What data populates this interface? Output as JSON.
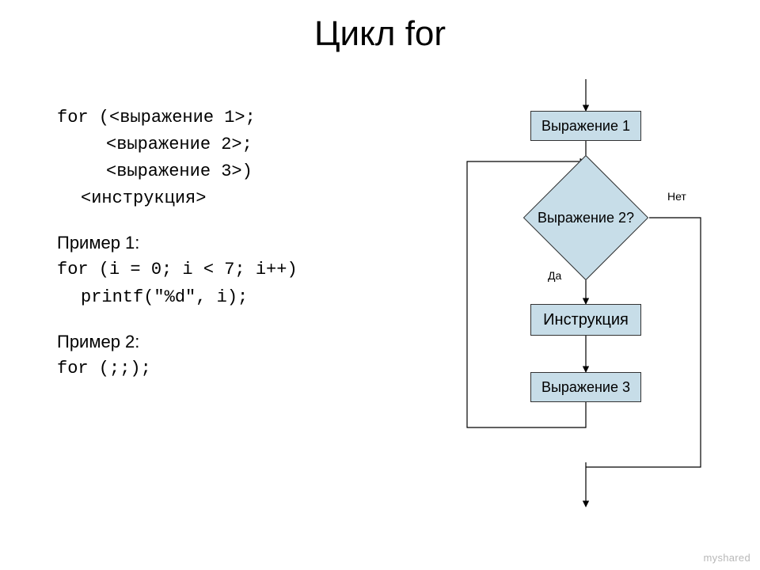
{
  "title": "Цикл for",
  "code": {
    "l1": "for (<выражение 1>;",
    "l2": "<выражение 2>;",
    "l3": "<выражение 3>)",
    "l4": "<инструкция>"
  },
  "ex1": {
    "heading": "Пример 1:",
    "l1": "for (i = 0; i < 7; i++)",
    "l2": "printf(\"%d\", i);"
  },
  "ex2": {
    "heading": "Пример 2:",
    "l1": "for (;;);"
  },
  "flow": {
    "init": "Выражение 1",
    "cond": "Выражение 2?",
    "body": "Инструкция",
    "step": "Выражение 3",
    "yes": "Да",
    "no": "Нет"
  },
  "watermark": "myshared"
}
